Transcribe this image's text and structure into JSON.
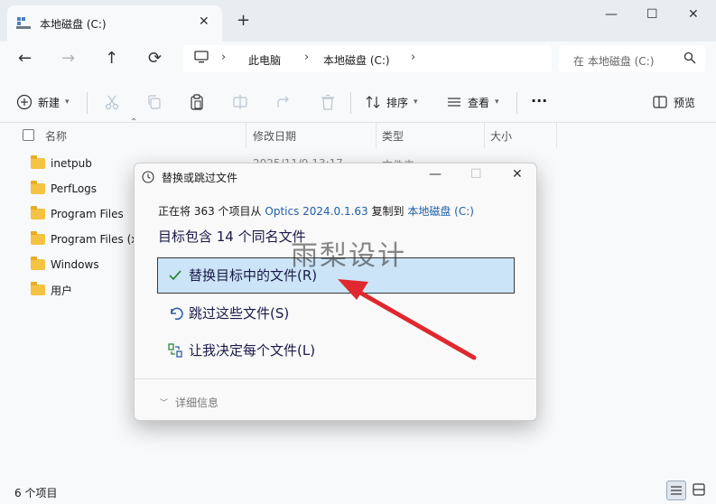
{
  "tab": {
    "title": "本地磁盘 (C:)",
    "close": "✕",
    "new_tab": "+"
  },
  "window_controls": {
    "minimize": "—",
    "maximize": "☐",
    "close": "✕"
  },
  "nav": {
    "back": "←",
    "forward": "→",
    "up": "↑",
    "refresh": "⟳"
  },
  "address": {
    "crumbs": [
      "此电脑",
      "本地磁盘 (C:)"
    ],
    "separator": "›"
  },
  "search": {
    "placeholder": "在 本地磁盘 (C:)"
  },
  "toolbar": {
    "new_label": "新建",
    "sort_label": "排序",
    "view_label": "查看",
    "more": "···",
    "preview_label": "预览"
  },
  "columns": {
    "name": "名称",
    "modified": "修改日期",
    "type": "类型",
    "size": "大小"
  },
  "files": [
    {
      "name": "inetpub",
      "modified": "2025/11/9 13:17",
      "type": "文件夹"
    },
    {
      "name": "PerfLogs"
    },
    {
      "name": "Program Files"
    },
    {
      "name": "Program Files (x"
    },
    {
      "name": "Windows"
    },
    {
      "name": "用户"
    }
  ],
  "status": {
    "count": "6 个项目"
  },
  "dialog": {
    "title": "替换或跳过文件",
    "progress_prefix": "正在将 363 个项目从",
    "source": "Optics 2024.0.1.63",
    "progress_mid": "复制到",
    "destination": "本地磁盘 (C:)",
    "heading": "目标包含 14 个同名文件",
    "options": {
      "replace": "替换目标中的文件(R)",
      "skip": "跳过这些文件(S)",
      "decide": "让我决定每个文件(L)"
    },
    "details": "详细信息",
    "controls": {
      "minimize": "—",
      "maximize": "☐",
      "close": "✕"
    }
  },
  "watermark": "雨梨设计",
  "colors": {
    "accent": "#1f5fa8",
    "selected_bg": "#cce4f7",
    "arrow": "#e0282e",
    "folder": "#f5c242"
  }
}
